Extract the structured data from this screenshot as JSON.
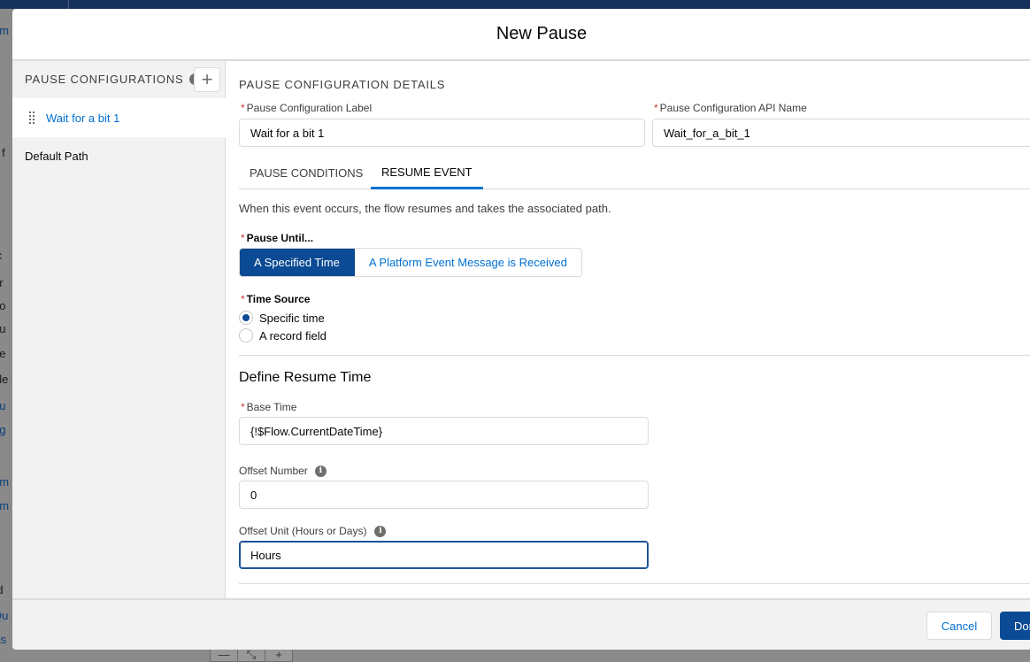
{
  "background": {
    "fragments": [
      "em",
      "s f",
      "e",
      "tc",
      "gr",
      "no",
      "eu",
      "ue",
      "gle",
      "eu",
      "ag",
      ")",
      "em",
      "em",
      "rd",
      "Qu",
      "As"
    ],
    "canvas_tools": [
      "—",
      "⤡",
      "+"
    ]
  },
  "modal": {
    "title": "New Pause",
    "sidebar": {
      "header": "PAUSE CONFIGURATIONS",
      "add_icon": "plus-icon",
      "items": [
        {
          "label": "Wait for a bit 1",
          "active": true
        },
        {
          "label": "Default Path",
          "active": false
        }
      ]
    },
    "details": {
      "section_title": "PAUSE CONFIGURATION DETAILS",
      "label_field": {
        "label": "Pause Configuration Label",
        "value": "Wait for a bit 1",
        "required": "*"
      },
      "api_name_field": {
        "label": "Pause Configuration API Name",
        "value": "Wait_for_a_bit_1",
        "required": "*"
      },
      "tabs": [
        {
          "label": "PAUSE CONDITIONS",
          "active": false
        },
        {
          "label": "RESUME EVENT",
          "active": true
        }
      ],
      "description": "When this event occurs, the flow resumes and takes the associated path.",
      "pause_until": {
        "label": "Pause Until...",
        "options": [
          "A Specified Time",
          "A Platform Event Message is Received"
        ],
        "selected": "A Specified Time"
      },
      "time_source": {
        "label": "Time Source",
        "options": [
          "Specific time",
          "A record field"
        ],
        "selected": "Specific time"
      },
      "resume_section": {
        "title": "Define Resume Time",
        "base_time": {
          "label": "Base Time",
          "value": "{!$Flow.CurrentDateTime}"
        },
        "offset_number": {
          "label": "Offset Number",
          "value": "0"
        },
        "offset_unit": {
          "label": "Offset Unit (Hours or Days)",
          "value": "Hours"
        }
      }
    },
    "footer": {
      "cancel_label": "Cancel",
      "done_label": "Done"
    }
  },
  "colors": {
    "brand": "#0b4a94",
    "link": "#0070d2",
    "required": "#c23934"
  }
}
